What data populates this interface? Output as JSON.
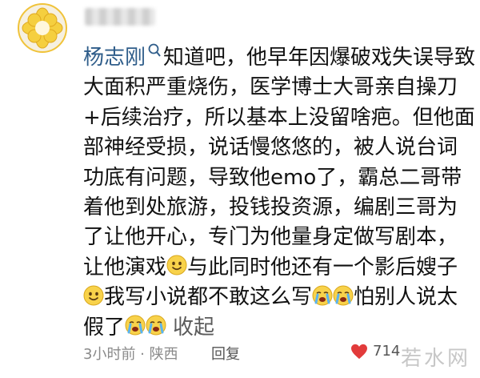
{
  "comment": {
    "author": "杨志刚",
    "author_icon": "user-tag-icon",
    "lines": [
      "知道吧，他早年因爆破戏失误导致",
      "大面积严重烧伤，医学博士大哥亲自操刀",
      "+后续治疗，所以基本上没留啥疤。但他面",
      "部神经受损，说话慢悠悠的，被人说台词",
      "功底有问题，导致他emo了，霸总二哥带",
      "着他到处旅游，投钱投资源，编剧三哥为",
      "了让他开心，专门为他量身定做写剧本，",
      "让他演戏",
      "与此同时他还有一个影后嫂子",
      "我写小说都不敢这么写",
      "怕别人说太",
      "假了"
    ],
    "emoji_smile": "smile-emoji-icon",
    "emoji_cry": "crying-emoji-icon",
    "collapse_label": "收起"
  },
  "footer": {
    "time_location": "3小时前 · 陕西",
    "reply_label": "回复",
    "like_count": "714"
  },
  "watermark": "若水网",
  "colors": {
    "author": "#2f5d8a",
    "like_heart": "#e23b3b",
    "meta_text": "#8a8a8a"
  }
}
